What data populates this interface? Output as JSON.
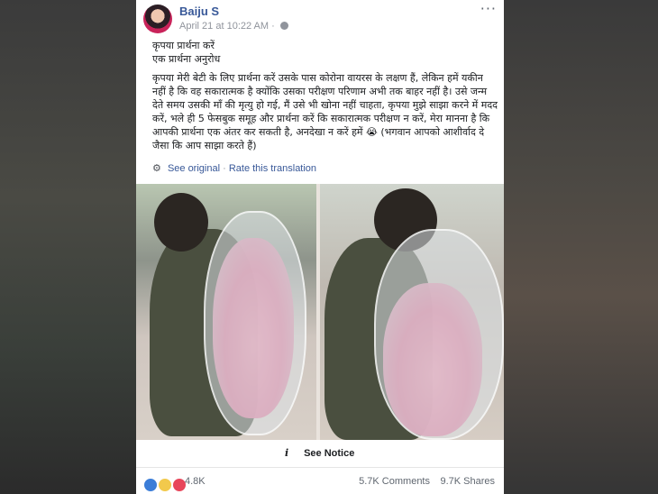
{
  "post": {
    "author": "Baiju S",
    "timestamp": "April 21 at 10:22 AM",
    "more_icon": "···",
    "privacy_icon": "globe-icon",
    "paragraph1": "कृपया प्रार्थना करें\nएक प्रार्थना अनुरोध",
    "paragraph2": "कृपया मेरी बेटी के लिए प्रार्थना करें उसके पास कोरोना वायरस के लक्षण हैं, लेकिन हमें यकीन नहीं है कि वह सकारात्मक है क्योंकि उसका परीक्षण परिणाम अभी तक बाहर नहीं है। उसे जन्म देते समय उसकी माँ की मृत्यु हो गई, मैं उसे भी खोना नहीं चाहता, कृपया मुझे साझा करने में मदद करें, भले ही 5 फेसबुक समूह और प्रार्थना करें कि सकारात्मक परीक्षण न करें, मेरा मानना है कि आपकी प्रार्थना एक अंतर कर सकती है, अनदेखा न करें हमें 😭 (भगवान आपको आशीर्वाद दे जैसा कि आप साझा करते हैं)",
    "see_original": "See original",
    "separator": " · ",
    "rate_translation": "Rate this translation",
    "notice_icon": "i",
    "notice": "See Notice",
    "reaction_count": "4.8K",
    "comments": "5.7K Comments",
    "shares": "9.7K Shares"
  },
  "colors": {
    "link": "#385898",
    "muted": "#90949c",
    "like": "#3b7dd8",
    "love": "#e8465b",
    "sad": "#f2c94c"
  }
}
